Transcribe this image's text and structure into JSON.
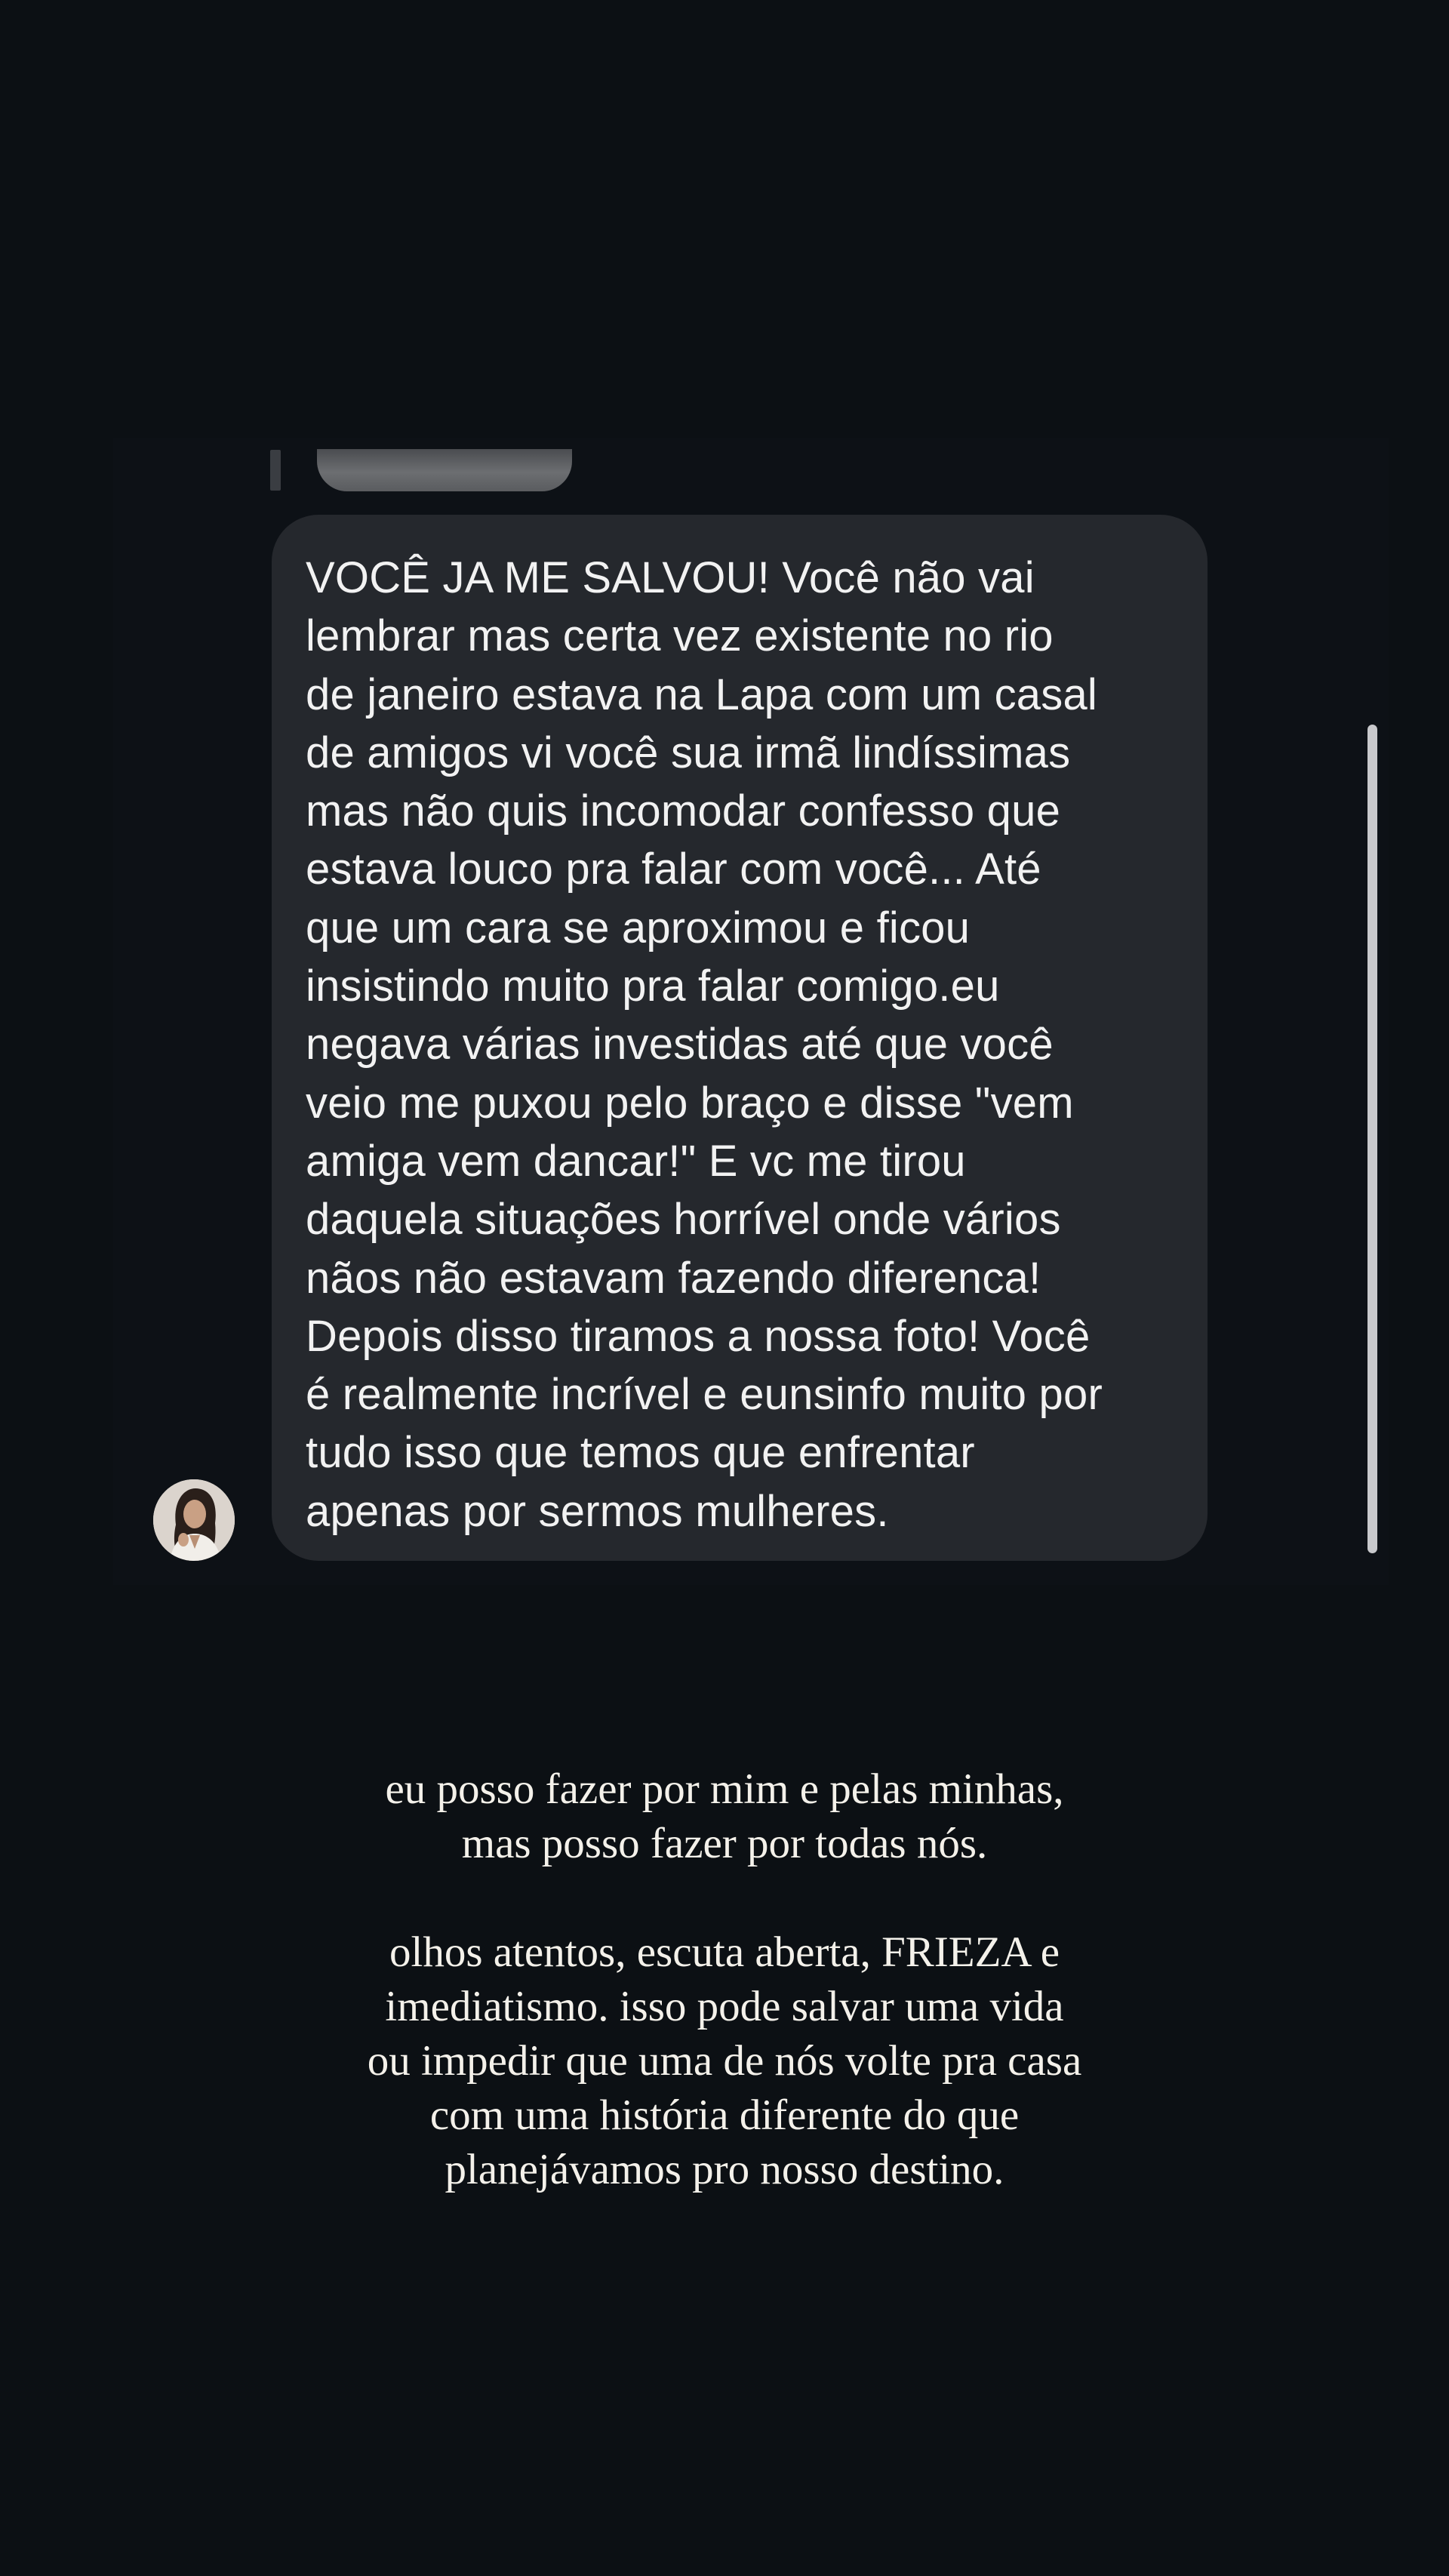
{
  "message": {
    "text": "VOCÊ JA ME SALVOU!  Você não vai\nlembrar mas certa vez existente no rio\nde janeiro estava na Lapa com um casal\nde amigos vi você sua irmã lindíssimas\nmas não quis incomodar confesso que\nestava louco pra falar com você... Até\nque um cara se aproximou e ficou\ninsistindo muito pra falar comigo.eu\nnegava várias investidas até que você\nveio me puxou pelo braço e disse \"vem\namiga vem dancar!\" E vc me tirou\ndaquela situações horrível onde vários\nnãos não estavam fazendo diferenca!\nDepois disso tiramos a nossa foto! Você\né realmente incrível e eunsinfo muito por\ntudo isso que temos que enfrentar\napenas por sermos mulheres."
  },
  "caption": {
    "paragraph1": "eu posso fazer por mim e pelas minhas,\nmas posso fazer por todas nós.",
    "paragraph2": "olhos atentos, escuta aberta, FRIEZA e\nimediatismo. isso pode salvar uma vida\nou impedir que uma de nós volte pra casa\ncom uma história diferente do que\nplanejávamos pro nosso destino."
  },
  "colors": {
    "background": "#0c1014",
    "bubble": "#25282d",
    "text": "#f2f2f2"
  },
  "icons": {
    "avatar": "profile-photo"
  }
}
